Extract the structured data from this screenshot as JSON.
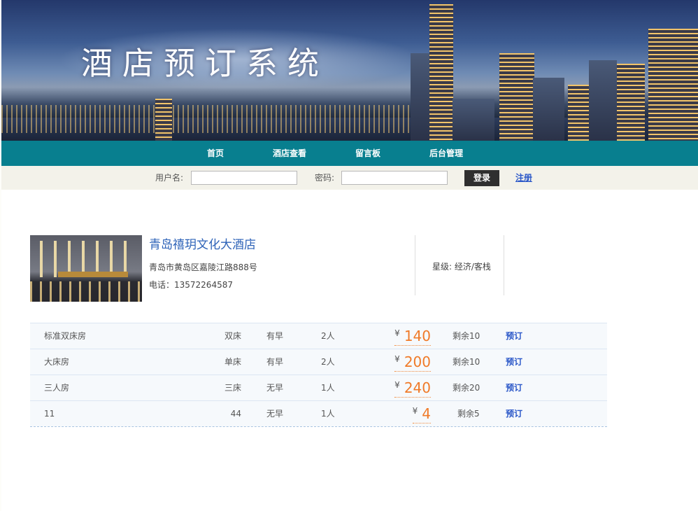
{
  "banner": {
    "title": "酒店预订系统"
  },
  "nav": {
    "items": [
      {
        "label": "首页"
      },
      {
        "label": "酒店查看"
      },
      {
        "label": "留言板"
      },
      {
        "label": "后台管理"
      }
    ]
  },
  "login": {
    "username_label": "用户名:",
    "username_value": "",
    "password_label": "密码:",
    "password_value": "",
    "login_button": "登录",
    "register_link": "注册"
  },
  "hotel": {
    "name": "青岛禧玥文化大酒店",
    "address": "青岛市黄岛区嘉陵江路888号",
    "phone": "电话：13572264587",
    "star": "星级: 经济/客栈"
  },
  "rooms": [
    {
      "name": "标准双床房",
      "bed": "双床",
      "breakfast": "有早",
      "people": "2人",
      "currency": "¥",
      "price": "140",
      "remaining": "剩余10",
      "book": "预订"
    },
    {
      "name": "大床房",
      "bed": "单床",
      "breakfast": "有早",
      "people": "2人",
      "currency": "¥",
      "price": "200",
      "remaining": "剩余10",
      "book": "预订"
    },
    {
      "name": "三人房",
      "bed": "三床",
      "breakfast": "无早",
      "people": "1人",
      "currency": "¥",
      "price": "240",
      "remaining": "剩余20",
      "book": "预订"
    },
    {
      "name": "11",
      "bed": "44",
      "breakfast": "无早",
      "people": "1人",
      "currency": "¥",
      "price": "4",
      "remaining": "剩余5",
      "book": "预订"
    }
  ],
  "colors": {
    "nav_bg": "#087f8f",
    "price": "#f07a28",
    "link": "#2a57c8",
    "hotel_name": "#2e63b8"
  }
}
